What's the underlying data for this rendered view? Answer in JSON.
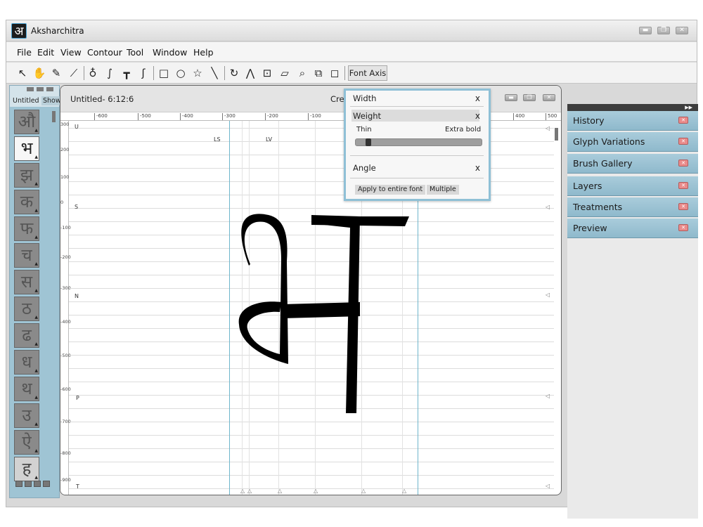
{
  "app": {
    "title": "Aksharchitra",
    "logo_glyph": "अ"
  },
  "window_controls": {
    "minimize": "▬",
    "maximize": "❐",
    "close": "✕"
  },
  "menu": [
    "File",
    "Edit",
    "View",
    "Contour",
    "Tool",
    "Window",
    "Help"
  ],
  "toolbar": {
    "tools": [
      "pointer-icon",
      "hand-icon",
      "eraser-icon",
      "ruler-icon",
      "pen-icon",
      "curve-icon",
      "t-junction-icon",
      "hook-icon",
      "rectangle-icon",
      "ellipse-icon",
      "star-icon",
      "line-icon",
      "rotate-icon",
      "mirror-icon",
      "scale-icon",
      "skew-icon",
      "zoom-icon",
      "copy-icon",
      "shape-icon"
    ],
    "tool_glyphs": [
      "↖",
      "✋",
      "✎",
      "⟋",
      "♁",
      "∫",
      "┳",
      "ʃ",
      "□",
      "○",
      "☆",
      "╲",
      "↻",
      "⋀",
      "⊡",
      "▱",
      "⌕",
      "⧉",
      "◻"
    ],
    "font_axis_label": "Font Axis"
  },
  "left_panel": {
    "doc_label": "Untitled",
    "show_label": "Show",
    "glyphs": [
      "औ",
      "भ",
      "झ",
      "क",
      "फ",
      "च",
      "स",
      "ठ",
      "ढ",
      "ध",
      "थ",
      "उ",
      "ऐ",
      "ह"
    ]
  },
  "document": {
    "title": "Untitled- 6:12:6",
    "create_label": "Crea",
    "ruler_x": [
      "-600",
      "-500",
      "-400",
      "-300",
      "-200",
      "-100",
      "400",
      "500"
    ],
    "ruler_y": [
      "300",
      "200",
      "100",
      "0",
      "-100",
      "-200",
      "-300",
      "-400",
      "-500",
      "-600",
      "-700",
      "-800",
      "-900"
    ],
    "guide_labels": {
      "U": "U",
      "S": "S",
      "N": "N",
      "P": "P",
      "T": "T",
      "LS": "LS",
      "LV": "LV"
    },
    "glyph": "भ"
  },
  "font_axis_popup": {
    "width_label": "Width",
    "weight_label": "Weight",
    "thin_label": "Thin",
    "extra_bold_label": "Extra bold",
    "angle_label": "Angle",
    "close": "x",
    "weight_value": 0.08,
    "apply_button": "Apply to entire font",
    "multiple_button": "Multiple"
  },
  "right_panel": {
    "header_arrows": "▶▶",
    "items": [
      "History",
      "Glyph Variations",
      "Brush Gallery",
      "Layers",
      "Treatments",
      "Preview"
    ]
  }
}
